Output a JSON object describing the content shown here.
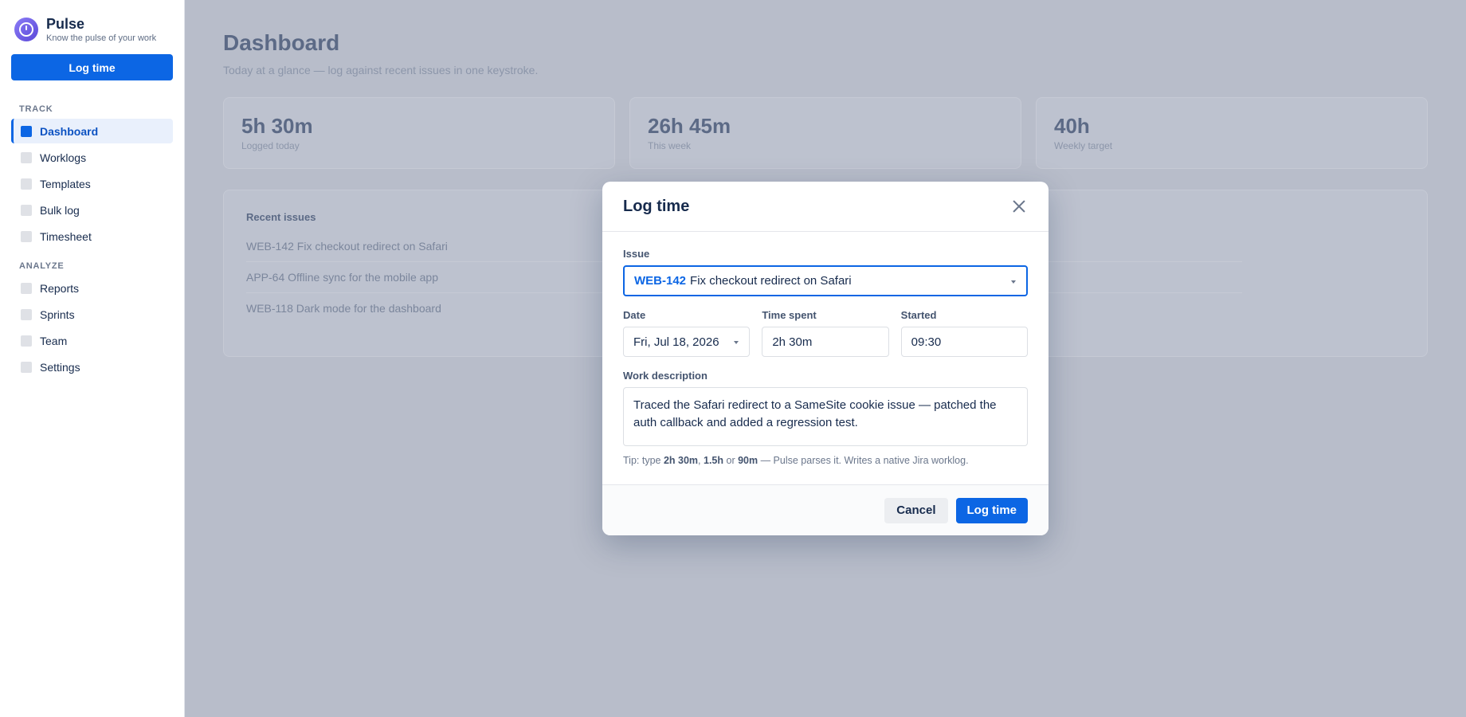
{
  "brand": {
    "name": "Pulse",
    "tagline": "Know the pulse of your work",
    "logo_icon": "pulse-stopwatch-icon"
  },
  "sidebar": {
    "cta_label": "Log time",
    "sections": [
      {
        "title": "TRACK",
        "items": [
          "Dashboard",
          "Worklogs",
          "Templates",
          "Bulk log",
          "Timesheet"
        ]
      },
      {
        "title": "ANALYZE",
        "items": [
          "Reports",
          "Sprints",
          "Team",
          "Settings"
        ]
      }
    ],
    "active_item": "Dashboard"
  },
  "main": {
    "title": "Dashboard",
    "subtitle": "Today at a glance — log against recent issues in one keystroke.",
    "stats": [
      {
        "value": "5h 30m",
        "label": "Logged today"
      },
      {
        "value": "26h 45m",
        "label": "This week"
      },
      {
        "value": "40h",
        "label": "Weekly target"
      }
    ],
    "recent": {
      "title": "Recent issues",
      "rows": [
        "WEB-142 Fix checkout redirect on Safari",
        "APP-64 Offline sync for the mobile app",
        "WEB-118 Dark mode for the dashboard"
      ]
    }
  },
  "modal": {
    "title": "Log time",
    "issue_label": "Issue",
    "issue_key": "WEB-142",
    "issue_summary": "Fix checkout redirect on Safari",
    "date_label": "Date",
    "date_value": "Fri, Jul 18, 2026",
    "time_label": "Time spent",
    "time_value": "2h 30m",
    "started_label": "Started",
    "started_value": "09:30",
    "desc_label": "Work description",
    "desc_value": "Traced the Safari redirect to a SameSite cookie issue — patched the auth callback and added a regression test.",
    "tip": {
      "prefix": "Tip: type ",
      "ex1": "2h 30m",
      "sep1": ", ",
      "ex2": "1.5h",
      "sep2": " or ",
      "ex3": "90m",
      "suffix": " — Pulse parses it. Writes a native Jira worklog."
    },
    "cancel_label": "Cancel",
    "submit_label": "Log time"
  },
  "colors": {
    "accent": "#0c66e4",
    "overlay": "#b8bdca",
    "text": "#172b4d"
  }
}
